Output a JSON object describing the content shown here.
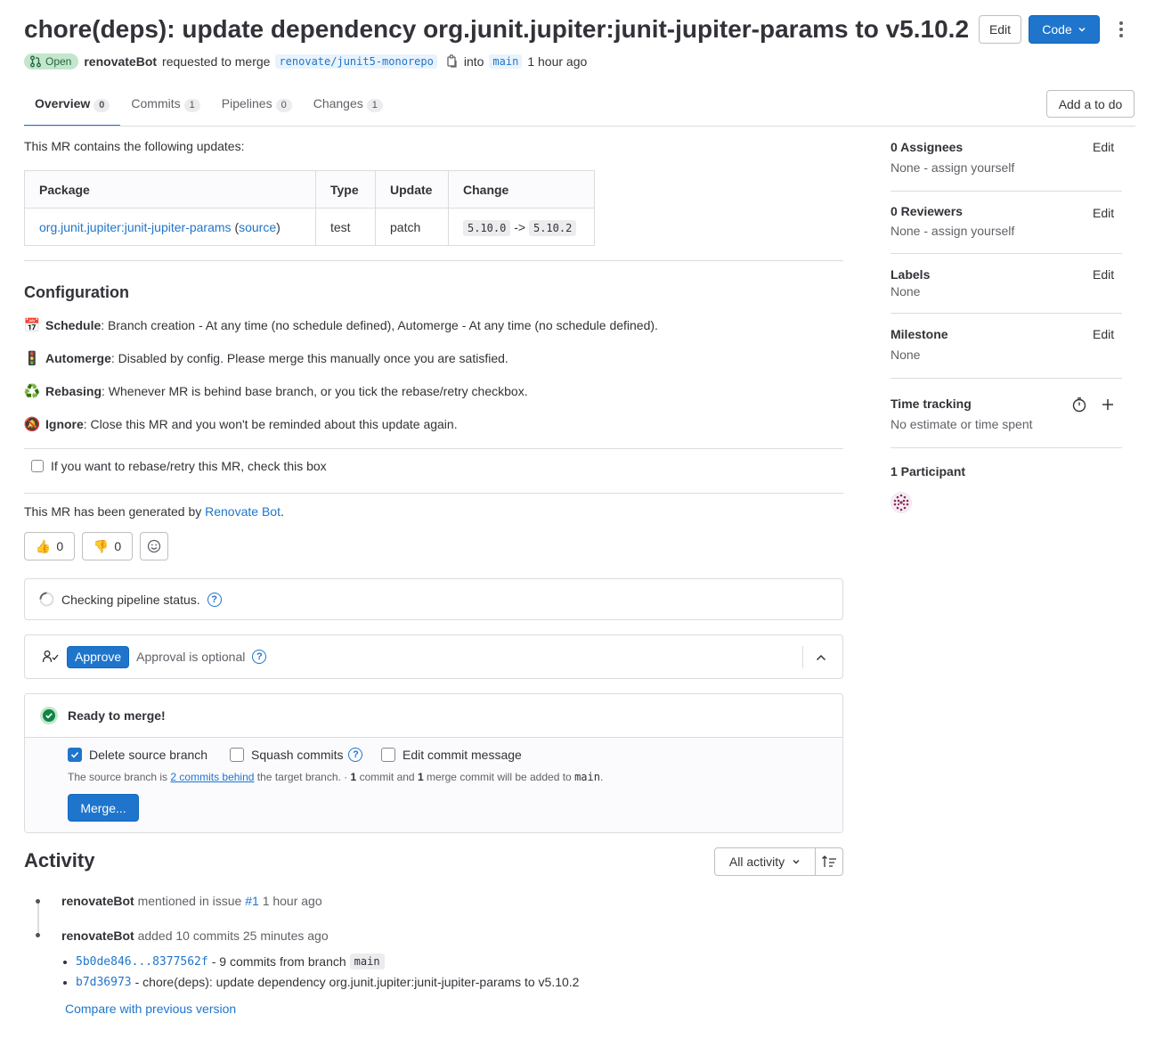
{
  "header": {
    "title": "chore(deps): update dependency org.junit.jupiter:junit-jupiter-params to v5.10.2",
    "edit_label": "Edit",
    "code_label": "Code",
    "status": "Open",
    "author": "renovateBot",
    "requested_text": "requested to merge",
    "source_branch": "renovate/junit5-monorepo",
    "into_text": "into",
    "target_branch": "main",
    "time": "1 hour ago"
  },
  "tabs": [
    {
      "label": "Overview",
      "count": "0"
    },
    {
      "label": "Commits",
      "count": "1"
    },
    {
      "label": "Pipelines",
      "count": "0"
    },
    {
      "label": "Changes",
      "count": "1"
    }
  ],
  "todo_label": "Add a to do",
  "description": {
    "intro": "This MR contains the following updates:",
    "table_headers": [
      "Package",
      "Type",
      "Update",
      "Change"
    ],
    "row": {
      "package": "org.junit.jupiter:junit-jupiter-params",
      "source_open": "(",
      "source": "source",
      "source_close": ")",
      "type": "test",
      "update": "patch",
      "from": "5.10.0",
      "arrow": "->",
      "to": "5.10.2"
    },
    "config_heading": "Configuration",
    "config": [
      {
        "emoji": "📅",
        "label": "Schedule",
        "text": ": Branch creation - At any time (no schedule defined), Automerge - At any time (no schedule defined)."
      },
      {
        "emoji": "🚦",
        "label": "Automerge",
        "text": ": Disabled by config. Please merge this manually once you are satisfied."
      },
      {
        "emoji": "♻️",
        "label": "Rebasing",
        "text": ": Whenever MR is behind base branch, or you tick the rebase/retry checkbox."
      },
      {
        "emoji": "🔕",
        "label": "Ignore",
        "text": ": Close this MR and you won't be reminded about this update again."
      }
    ],
    "rebase_checkbox": "If you want to rebase/retry this MR, check this box",
    "generated_prefix": "This MR has been generated by",
    "generated_link": "Renovate Bot",
    "generated_suffix": "."
  },
  "reactions": {
    "thumbs_up": "👍",
    "thumbs_up_count": "0",
    "thumbs_down": "👎",
    "thumbs_down_count": "0"
  },
  "pipeline": {
    "text": "Checking pipeline status."
  },
  "approval": {
    "approve_label": "Approve",
    "optional_text": "Approval is optional"
  },
  "merge": {
    "ready_text": "Ready to merge!",
    "delete_source": "Delete source branch",
    "squash": "Squash commits",
    "edit_message": "Edit commit message",
    "behind_prefix": "The source branch is",
    "behind_link": "2 commits behind",
    "behind_mid": "the target branch. ·",
    "commit_count": "1",
    "commit_mid": "commit and",
    "merge_count": "1",
    "merge_mid": "merge commit will be added to",
    "target": "main",
    "period": ".",
    "merge_button": "Merge..."
  },
  "activity": {
    "heading": "Activity",
    "filter": "All activity",
    "items": [
      {
        "author": "renovateBot",
        "text": "mentioned in issue",
        "link": "#1",
        "time": "1 hour ago"
      },
      {
        "author": "renovateBot",
        "text": "added 10 commits",
        "time": "25 minutes ago"
      }
    ],
    "commits": [
      {
        "sha": "5b0de846...8377562f",
        "text": "- 9 commits from branch",
        "branch": "main"
      },
      {
        "sha": "b7d36973",
        "text": "- chore(deps): update dependency org.junit.jupiter:junit-jupiter-params to v5.10.2"
      }
    ],
    "compare_link": "Compare with previous version"
  },
  "sidebar": {
    "assignees_title": "0 Assignees",
    "assignees_value": "None - assign yourself",
    "reviewers_title": "0 Reviewers",
    "reviewers_value": "None - assign yourself",
    "labels_title": "Labels",
    "labels_value": "None",
    "milestone_title": "Milestone",
    "milestone_value": "None",
    "time_title": "Time tracking",
    "time_value": "No estimate or time spent",
    "participants_title": "1 Participant",
    "edit_label": "Edit"
  },
  "colors": {
    "accent": "#1f75cb",
    "success": "#108548",
    "open_badge_bg": "#c3e6cd",
    "open_badge_fg": "#24663b"
  }
}
